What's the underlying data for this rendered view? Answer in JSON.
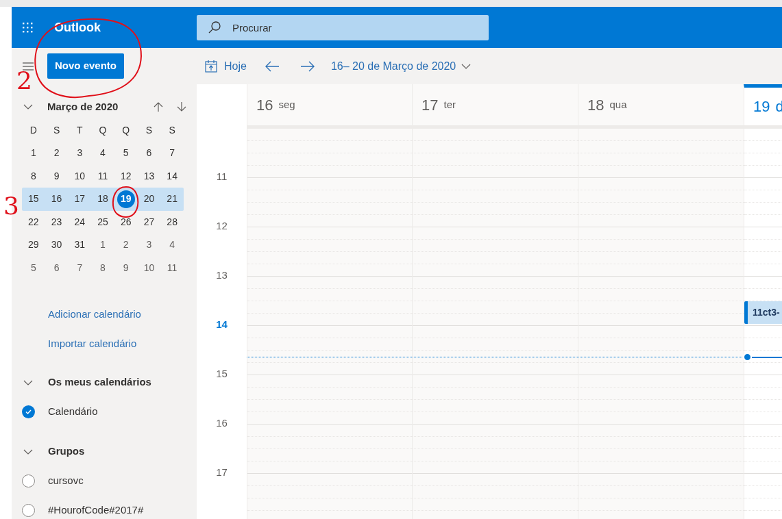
{
  "header": {
    "app_name": "Outlook",
    "search": {
      "placeholder": "Procurar"
    }
  },
  "toolbar": {
    "new_event": "Novo evento",
    "today": "Hoje",
    "date_range": "16– 20 de Março de 2020"
  },
  "mini_calendar": {
    "title": "Março de 2020",
    "expanded": true,
    "weekdays": [
      "D",
      "S",
      "T",
      "Q",
      "Q",
      "S",
      "S"
    ],
    "weeks": [
      {
        "selected": false,
        "days": [
          {
            "label": "1",
            "other_month": false,
            "today": false
          },
          {
            "label": "2",
            "other_month": false,
            "today": false
          },
          {
            "label": "3",
            "other_month": false,
            "today": false
          },
          {
            "label": "4",
            "other_month": false,
            "today": false
          },
          {
            "label": "5",
            "other_month": false,
            "today": false
          },
          {
            "label": "6",
            "other_month": false,
            "today": false
          },
          {
            "label": "7",
            "other_month": false,
            "today": false
          }
        ]
      },
      {
        "selected": false,
        "days": [
          {
            "label": "8",
            "other_month": false,
            "today": false
          },
          {
            "label": "9",
            "other_month": false,
            "today": false
          },
          {
            "label": "10",
            "other_month": false,
            "today": false
          },
          {
            "label": "11",
            "other_month": false,
            "today": false
          },
          {
            "label": "12",
            "other_month": false,
            "today": false
          },
          {
            "label": "13",
            "other_month": false,
            "today": false
          },
          {
            "label": "14",
            "other_month": false,
            "today": false
          }
        ]
      },
      {
        "selected": true,
        "days": [
          {
            "label": "15",
            "other_month": false,
            "today": false
          },
          {
            "label": "16",
            "other_month": false,
            "today": false
          },
          {
            "label": "17",
            "other_month": false,
            "today": false
          },
          {
            "label": "18",
            "other_month": false,
            "today": false
          },
          {
            "label": "19",
            "other_month": false,
            "today": true
          },
          {
            "label": "20",
            "other_month": false,
            "today": false
          },
          {
            "label": "21",
            "other_month": false,
            "today": false
          }
        ]
      },
      {
        "selected": false,
        "days": [
          {
            "label": "22",
            "other_month": false,
            "today": false
          },
          {
            "label": "23",
            "other_month": false,
            "today": false
          },
          {
            "label": "24",
            "other_month": false,
            "today": false
          },
          {
            "label": "25",
            "other_month": false,
            "today": false
          },
          {
            "label": "26",
            "other_month": false,
            "today": false
          },
          {
            "label": "27",
            "other_month": false,
            "today": false
          },
          {
            "label": "28",
            "other_month": false,
            "today": false
          }
        ]
      },
      {
        "selected": false,
        "days": [
          {
            "label": "29",
            "other_month": false,
            "today": false
          },
          {
            "label": "30",
            "other_month": false,
            "today": false
          },
          {
            "label": "31",
            "other_month": false,
            "today": false
          },
          {
            "label": "1",
            "other_month": true,
            "today": false
          },
          {
            "label": "2",
            "other_month": true,
            "today": false
          },
          {
            "label": "3",
            "other_month": true,
            "today": false
          },
          {
            "label": "4",
            "other_month": true,
            "today": false
          }
        ]
      },
      {
        "selected": false,
        "days": [
          {
            "label": "5",
            "other_month": true,
            "today": false
          },
          {
            "label": "6",
            "other_month": true,
            "today": false
          },
          {
            "label": "7",
            "other_month": true,
            "today": false
          },
          {
            "label": "8",
            "other_month": true,
            "today": false
          },
          {
            "label": "9",
            "other_month": true,
            "today": false
          },
          {
            "label": "10",
            "other_month": true,
            "today": false
          },
          {
            "label": "11",
            "other_month": true,
            "today": false
          }
        ]
      }
    ]
  },
  "links": [
    "Adicionar calendário",
    "Importar calendário"
  ],
  "sections": [
    {
      "title": "Os meus calendários",
      "expanded": true,
      "items": [
        {
          "label": "Calendário",
          "checked": true
        }
      ]
    },
    {
      "title": "Grupos",
      "expanded": true,
      "items": [
        {
          "label": "cursovc",
          "checked": false
        },
        {
          "label": "#HourofCode#2017#",
          "checked": false
        }
      ]
    }
  ],
  "week_view": {
    "days": [
      {
        "number": "16",
        "weekday": "seg",
        "today": false
      },
      {
        "number": "17",
        "weekday": "ter",
        "today": false
      },
      {
        "number": "18",
        "weekday": "qua",
        "today": false
      },
      {
        "number": "19",
        "weekday": "d",
        "today": true,
        "events": [
          {
            "title": "11ct3-"
          }
        ]
      }
    ],
    "hours": [
      {
        "label": "11",
        "current": false
      },
      {
        "label": "12",
        "current": false
      },
      {
        "label": "13",
        "current": false
      },
      {
        "label": "14",
        "current": true
      },
      {
        "label": "15",
        "current": false
      },
      {
        "label": "16",
        "current": false
      },
      {
        "label": "17",
        "current": false
      }
    ]
  },
  "annotations": [
    {
      "label": "2"
    },
    {
      "label": "3"
    }
  ]
}
